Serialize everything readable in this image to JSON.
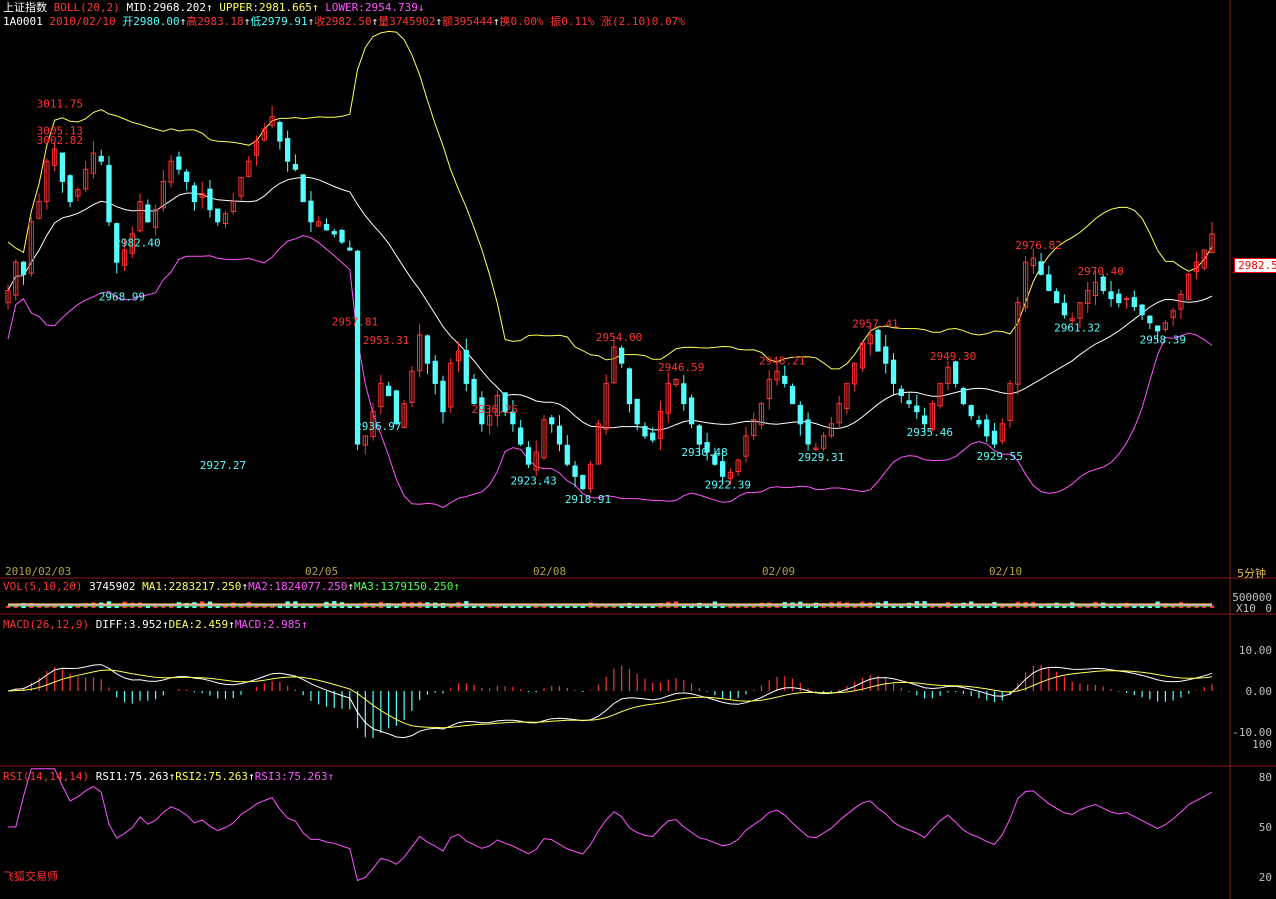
{
  "header": {
    "index_name": "上证指数",
    "boll_label": "BOLL(20,2)",
    "mid_label": "MID:2968.202",
    "upper_label": "UPPER:2981.665",
    "lower_label": "LOWER:2954.739",
    "code": "1A0001",
    "date": "2010/02/10",
    "open": "开2980.00",
    "high": "高2983.18",
    "low": "低2979.91",
    "close": "收2982.50",
    "volume": "量3745902",
    "amount": "额395444",
    "turnover": "换0.00%",
    "amplitude": "振0.11%",
    "change": "涨(2.10)0.07%"
  },
  "price_badge": "2982.5",
  "x_axis": {
    "labels": [
      "2010/02/03",
      "02/05",
      "02/08",
      "02/09",
      "02/10"
    ],
    "unit": "5分钟"
  },
  "vol_panel": {
    "title": "VOL(5,10,20)",
    "value": "3745902",
    "ma1": "MA1:2283217.250",
    "ma2": "MA2:1824077.250",
    "ma3": "MA3:1379150.250",
    "right_top": "500000",
    "right_bottom": "X10",
    "right_zero": "0"
  },
  "macd_panel": {
    "title": "MACD(26,12,9)",
    "diff": "DIFF:3.952",
    "dea": "DEA:2.459",
    "macd": "MACD:2.985",
    "ticks": [
      "10.00",
      "0.00",
      "-10.00"
    ]
  },
  "rsi_panel": {
    "title": "RSI(14,14,14)",
    "rsi1": "RSI1:75.263",
    "rsi2": "RSI2:75.263",
    "rsi3": "RSI3:75.263",
    "ticks": [
      "100",
      "80",
      "50",
      "20"
    ]
  },
  "brand": "飞狐交易师",
  "colors": {
    "up": "#ff3232",
    "down": "#54ffff",
    "upper": "#ffff54",
    "mid": "#ffffff",
    "lower": "#ff54ff",
    "axis": "#c03030"
  },
  "chart_data": {
    "type": "candlestick",
    "title": "上证指数 5分钟",
    "annotations": [
      {
        "label": "3005.13",
        "color": "up"
      },
      {
        "label": "3002.82",
        "color": "up"
      },
      {
        "label": "3011.75",
        "color": "up"
      },
      {
        "label": "2968.99",
        "color": "down"
      },
      {
        "label": "2982.40",
        "color": "down"
      },
      {
        "label": "2927.27",
        "color": "down"
      },
      {
        "label": "2957.81",
        "color": "up"
      },
      {
        "label": "2953.31",
        "color": "up"
      },
      {
        "label": "2936.97",
        "color": "down"
      },
      {
        "label": "2936.25",
        "color": "up"
      },
      {
        "label": "2923.43",
        "color": "down"
      },
      {
        "label": "2918.91",
        "color": "down"
      },
      {
        "label": "2954.00",
        "color": "up"
      },
      {
        "label": "2946.59",
        "color": "up"
      },
      {
        "label": "2930.48",
        "color": "down"
      },
      {
        "label": "2922.39",
        "color": "down"
      },
      {
        "label": "2948.21",
        "color": "up"
      },
      {
        "label": "2929.31",
        "color": "down"
      },
      {
        "label": "2957.41",
        "color": "up"
      },
      {
        "label": "2949.30",
        "color": "up"
      },
      {
        "label": "2935.46",
        "color": "down"
      },
      {
        "label": "2929.55",
        "color": "down"
      },
      {
        "label": "2976.82",
        "color": "up"
      },
      {
        "label": "2961.32",
        "color": "down"
      },
      {
        "label": "2970.40",
        "color": "up"
      },
      {
        "label": "2958.39",
        "color": "down"
      }
    ],
    "closes": [
      2968,
      2975,
      2972,
      2985,
      2990,
      3000,
      3003,
      2995,
      2990,
      2993,
      2998,
      3002,
      3000,
      2985,
      2975,
      2978,
      2982,
      2990,
      2985,
      2988,
      2995,
      3000,
      2998,
      2995,
      2990,
      2992,
      2988,
      2985,
      2987,
      2990,
      2996,
      3000,
      3005,
      3008,
      3011,
      3005,
      3000,
      2998,
      2990,
      2985,
      2985,
      2983,
      2982,
      2980,
      2978,
      2930,
      2932,
      2938,
      2945,
      2942,
      2935,
      2940,
      2948,
      2957,
      2950,
      2945,
      2938,
      2950,
      2953,
      2945,
      2940,
      2935,
      2937,
      2942,
      2938,
      2935,
      2930,
      2925,
      2928,
      2936,
      2935,
      2930,
      2925,
      2922,
      2919,
      2925,
      2935,
      2945,
      2954,
      2950,
      2940,
      2935,
      2932,
      2931,
      2938,
      2945,
      2946,
      2940,
      2935,
      2930,
      2928,
      2925,
      2922,
      2923,
      2926,
      2932,
      2936,
      2940,
      2946,
      2948,
      2945,
      2940,
      2935,
      2930,
      2929,
      2932,
      2935,
      2940,
      2945,
      2950,
      2955,
      2957,
      2953,
      2950,
      2945,
      2942,
      2940,
      2938,
      2935,
      2940,
      2945,
      2949,
      2945,
      2940,
      2937,
      2935,
      2932,
      2930,
      2935,
      2945,
      2965,
      2975,
      2976,
      2972,
      2968,
      2965,
      2962,
      2961,
      2965,
      2968,
      2970,
      2968,
      2966,
      2965,
      2966,
      2964,
      2962,
      2960,
      2958,
      2960,
      2963,
      2967,
      2972,
      2975,
      2978,
      2982
    ]
  }
}
